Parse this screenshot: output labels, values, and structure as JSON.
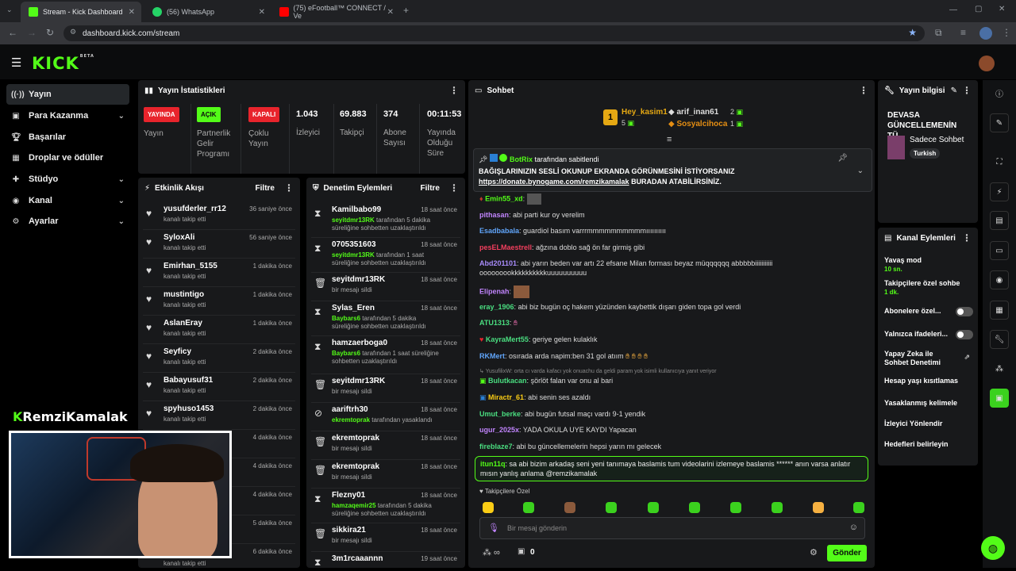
{
  "browser": {
    "tabs": [
      {
        "label": "Stream - Kick Dashboard",
        "color": "#53fc18"
      },
      {
        "label": "(56) WhatsApp",
        "color": "#25d366"
      },
      {
        "label": "(75) eFootball™ CONNECT / Ve",
        "color": "#ff0000"
      }
    ],
    "url": "dashboard.kick.com/stream"
  },
  "brand": {
    "logo": "KICK",
    "beta": "BETA",
    "accent": "#53fc18"
  },
  "nav": {
    "items": [
      {
        "label": "Yayın",
        "icon": "broadcast-icon",
        "active": true
      },
      {
        "label": "Para Kazanma",
        "icon": "money-icon",
        "chevron": true
      },
      {
        "label": "Başarılar",
        "icon": "trophy-icon"
      },
      {
        "label": "Droplar ve ödüller",
        "icon": "gift-icon"
      },
      {
        "label": "Stüdyo",
        "icon": "studio-icon",
        "chevron": true
      },
      {
        "label": "Kanal",
        "icon": "channel-icon",
        "chevron": true
      },
      {
        "label": "Ayarlar",
        "icon": "gear-icon",
        "chevron": true
      }
    ]
  },
  "stats": {
    "title": "Yayın İstatistikleri",
    "items": [
      {
        "badge": "YAYINDA",
        "label": "Yayın",
        "color": "#e8242c"
      },
      {
        "badge": "AÇIK",
        "label": "Partnerlik Gelir Programı",
        "color": "#53fc18"
      },
      {
        "badge": "KAPALI",
        "label": "Çoklu Yayın",
        "color": "#e8242c"
      },
      {
        "value": "1.043",
        "label": "İzleyici"
      },
      {
        "value": "69.883",
        "label": "Takipçi"
      },
      {
        "value": "374",
        "label": "Abone Sayısı"
      },
      {
        "value": "00:11:53",
        "label": "Yayında Olduğu Süre"
      }
    ]
  },
  "activity": {
    "title": "Etkinlik Akışı",
    "filter": "Filtre",
    "rows": [
      {
        "name": "yusufderler_rr12",
        "sub": "kanalı takip etti",
        "time": "36 saniye önce"
      },
      {
        "name": "SyloxAli",
        "sub": "kanalı takip etti",
        "time": "56 saniye önce"
      },
      {
        "name": "Emirhan_5155",
        "sub": "kanalı takip etti",
        "time": "1 dakika önce"
      },
      {
        "name": "mustintigo",
        "sub": "kanalı takip etti",
        "time": "1 dakika önce"
      },
      {
        "name": "AslanEray",
        "sub": "kanalı takip etti",
        "time": "1 dakika önce"
      },
      {
        "name": "Seyficy",
        "sub": "kanalı takip etti",
        "time": "2 dakika önce"
      },
      {
        "name": "Babayusuf31",
        "sub": "kanalı takip etti",
        "time": "2 dakika önce"
      },
      {
        "name": "spyhuso1453",
        "sub": "kanalı takip etti",
        "time": "2 dakika önce"
      },
      {
        "name": "",
        "sub": "",
        "time": "4 dakika önce"
      },
      {
        "name": "",
        "sub": "",
        "time": "4 dakika önce"
      },
      {
        "name": "",
        "sub": "",
        "time": "4 dakika önce"
      },
      {
        "name": "",
        "sub": "",
        "time": "5 dakika önce"
      },
      {
        "name": "",
        "sub": "kanalı takip etti",
        "time": "6 dakika önce"
      }
    ]
  },
  "streamer_overlay": {
    "name": "RemziKamalak"
  },
  "moderation": {
    "title": "Denetim Eylemleri",
    "filter": "Filtre",
    "rows": [
      {
        "icon": "hourglass-icon",
        "name": "Kamilbabo99",
        "by": "seyitdmr13RK",
        "sub": "tarafından 5 dakika süreliğine sohbetten uzaklaştırıldı",
        "time": "18 saat önce"
      },
      {
        "icon": "hourglass-icon",
        "name": "0705351603",
        "by": "seyitdmr13RK",
        "sub": "tarafından 1 saat süreliğine sohbetten uzaklaştırıldı",
        "time": "18 saat önce"
      },
      {
        "icon": "trash-icon",
        "name": "seyitdmr13RK",
        "by": "",
        "sub": "bir mesajı sildi",
        "time": "18 saat önce"
      },
      {
        "icon": "hourglass-icon",
        "name": "Sylas_Eren",
        "by": "Baybars6",
        "sub": "tarafından 5 dakika süreliğine sohbetten uzaklaştırıldı",
        "time": "18 saat önce"
      },
      {
        "icon": "hourglass-icon",
        "name": "hamzaerboga0",
        "by": "Baybars6",
        "sub": "tarafından 1 saat süreliğine sohbetten uzaklaştırıldı",
        "time": "18 saat önce"
      },
      {
        "icon": "trash-icon",
        "name": "seyitdmr13RK",
        "by": "",
        "sub": "bir mesajı sildi",
        "time": "18 saat önce"
      },
      {
        "icon": "ban-icon",
        "name": "aariftrh30",
        "by": "ekremtoprak",
        "sub": "tarafından yasaklandı",
        "time": "18 saat önce"
      },
      {
        "icon": "trash-icon",
        "name": "ekremtoprak",
        "by": "",
        "sub": "bir mesajı sildi",
        "time": "18 saat önce"
      },
      {
        "icon": "trash-icon",
        "name": "ekremtoprak",
        "by": "",
        "sub": "bir mesajı sildi",
        "time": "18 saat önce"
      },
      {
        "icon": "hourglass-icon",
        "name": "Flezny01",
        "by": "hamzaqemir25",
        "sub": "tarafından 5 dakika süreliğine sohbetten uzaklaştırıldı",
        "time": "18 saat önce"
      },
      {
        "icon": "trash-icon",
        "name": "sikkira21",
        "by": "",
        "sub": "bir mesajı sildi",
        "time": "18 saat önce"
      },
      {
        "icon": "hourglass-icon",
        "name": "3m1rcaaannn",
        "by": "",
        "sub": "",
        "time": "19 saat önce"
      }
    ]
  },
  "chat": {
    "title": "Sohbet",
    "leaderboard": {
      "first": {
        "name": "Hey_kasim1",
        "count": "5",
        "rank": "1"
      },
      "second": {
        "name": "arif_inan61",
        "count": "2"
      },
      "third": {
        "name": "Sosyalcihoca",
        "count": "1"
      }
    },
    "pinned": {
      "by": "BotRix",
      "by_suffix": "tarafından sabitlendi",
      "text": "BAĞIŞLARINIZIN SESLİ OKUNUP EKRANDA GÖRÜNMESİNİ İSTİYORSANIZ",
      "link": "https://donate.bynogame.com/remzikamalak",
      "link_suffix": " BURADAN ATABİLİRSİNİZ."
    },
    "messages": [
      {
        "user": "Emin55_xd",
        "color": "#53fc18",
        "text": ""
      },
      {
        "user": "pithasan",
        "color": "#c084fc",
        "text": "abi parti kur oy verelim"
      },
      {
        "user": "Esadbabala",
        "color": "#60a5fa",
        "text": "guardiol basım varrrmmmmmmmmmmıııııııııı"
      },
      {
        "user": "pesELMaestrell",
        "color": "#f43f5e",
        "text": "ağzına doblo sağ ön far girmiş gibi"
      },
      {
        "user": "Abd201101",
        "color": "#a78bfa",
        "text": "abi yarın beden var artı 22 efsane Milan forması beyaz müqqqqqq abbbbbiiiiiiiiiii ooooooookkkkkkkkkkuuuuuuuuuu"
      },
      {
        "user": "Elipenah",
        "color": "#c084fc",
        "text": ""
      },
      {
        "user": "eray_1906",
        "color": "#4ade80",
        "text": "abi biz bugün oç hakem yüzünden kaybettik dışarı giden topa gol verdi"
      },
      {
        "user": "ATU1313",
        "color": "#4ade80",
        "text": ""
      },
      {
        "user": "KayraMert55",
        "color": "#4ade80",
        "text": "geriye gelen kulaklık"
      },
      {
        "user": "RKMert",
        "color": "#60a5fa",
        "text": "osırada arda napim:ben 31 gol atıım"
      },
      {
        "user": "YusufilixW",
        "color": "#888888",
        "text": "orta cı varda kafacı yok onuachu da geldi param yok isimli kullanıcıya yanıt veriyor"
      },
      {
        "user": "Bulutkacan",
        "color": "#4ade80",
        "text": "şörlöt falan var onu al bari"
      },
      {
        "user": "Miractr_61",
        "color": "#facc15",
        "text": "abi senin ses azaldı"
      },
      {
        "user": "Umut_berke",
        "color": "#4ade80",
        "text": "abi bugün futsal maçı vardı 9-1 yendik"
      },
      {
        "user": "ugur_2025x",
        "color": "#c084fc",
        "text": "YADA OKULA UYE KAYDI Yapacan"
      },
      {
        "user": "fireblaze7",
        "color": "#4ade80",
        "text": "abi bu güncellemelerin hepsi yarın mı gelecek"
      }
    ],
    "highlight": {
      "user": "itun11q",
      "text": "sa abi bizim arkadaş seni yeni tanımaya baslamis tum videolarini izlemeye baslamis ****** anın varsa anlatır mısın yanlış anlama @remzikamalak"
    },
    "followers_only": "Takipçilere Özel",
    "input_placeholder": "Bir mesaj gönderin",
    "send": "Gönder",
    "sub_count": "0"
  },
  "stream_info": {
    "title": "Yayın bilgisi",
    "stream_title": "DEVASA GÜNCELLEMENİN TÜ...",
    "category": "Sadece Sohbet",
    "tag": "Turkish"
  },
  "channel_actions": {
    "title": "Kanal Eylemleri",
    "items": [
      {
        "label": "Yavaş mod",
        "sub": "10 sn.",
        "type": "chevron"
      },
      {
        "label": "Takipçilere özel sohbe",
        "sub": "1 dk.",
        "type": "chevron"
      },
      {
        "label": "Abonelere özel...",
        "sub": "",
        "type": "toggle"
      },
      {
        "label": "Yalnızca ifadeleri...",
        "sub": "",
        "type": "toggle"
      },
      {
        "label": "Yapay Zeka ile Sohbet Denetimi",
        "sub": "",
        "type": "external"
      },
      {
        "label": "Hesap yaşı kısıtlamas",
        "sub": "",
        "type": "chevron"
      },
      {
        "label": "Yasaklanmış kelimele",
        "sub": "",
        "type": "chevron"
      },
      {
        "label": "İzleyici Yönlendir",
        "sub": "",
        "type": "none"
      },
      {
        "label": "Hedefleri belirleyin",
        "sub": "",
        "type": "chevron"
      }
    ]
  }
}
